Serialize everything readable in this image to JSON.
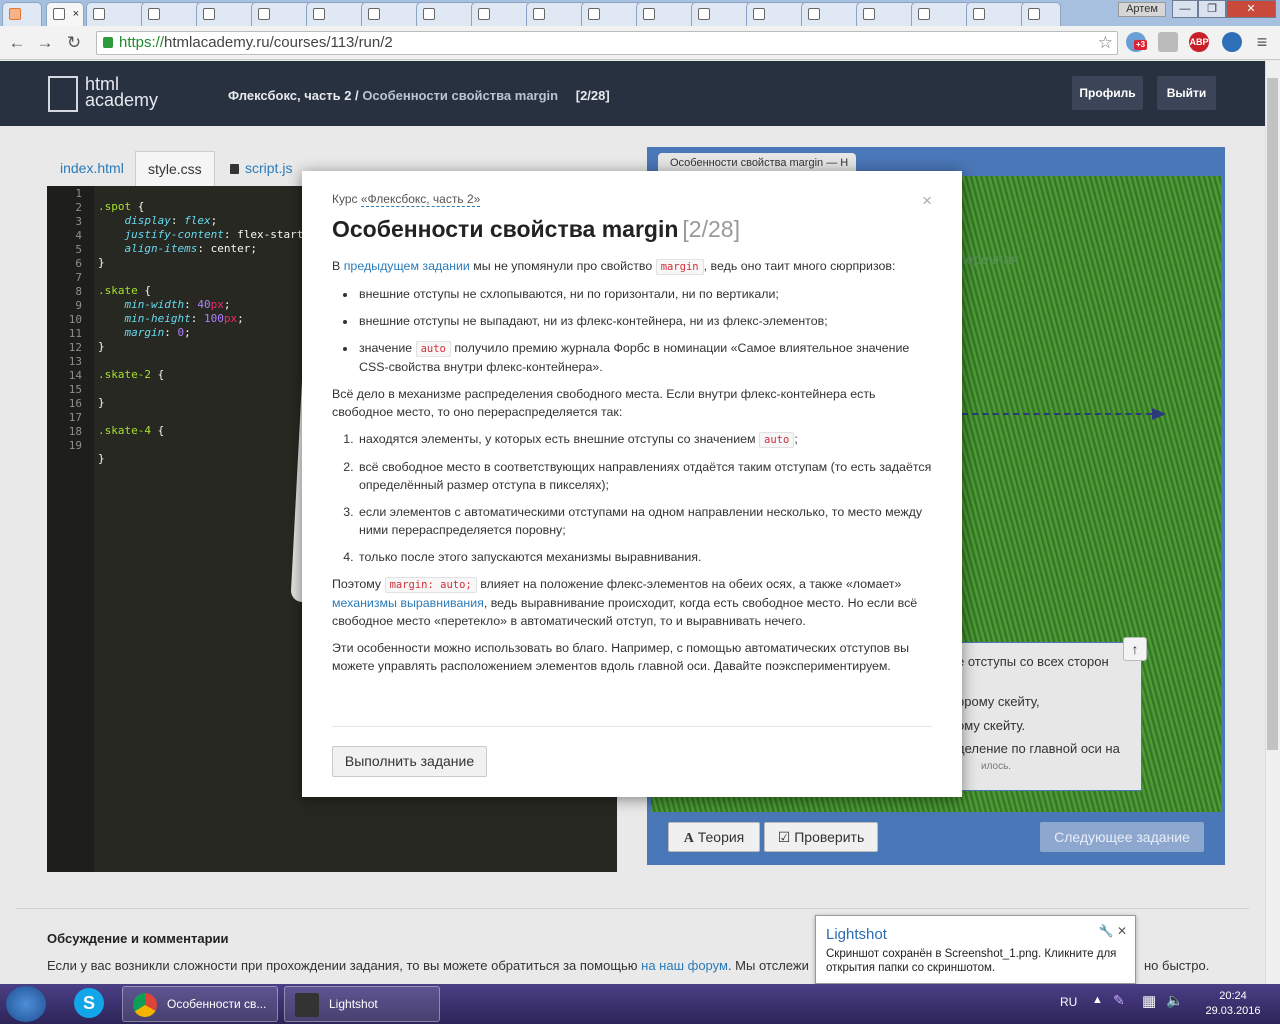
{
  "browser": {
    "tabs": [
      "",
      ""
    ],
    "active_tab_close": "×",
    "profile_name": "Артем",
    "window_controls": {
      "minimize": "—",
      "maximize": "❐",
      "close": "✕"
    },
    "url_protocol": "https://",
    "url_rest": "htmlacademy.ru/courses/113/run/2",
    "ext_badge": "+3",
    "abp": "ABP"
  },
  "site": {
    "logo_line1": "html",
    "logo_line2": "academy",
    "breadcrumb_course": "Флексбокс, часть 2 /",
    "breadcrumb_lesson": "Особенности свойства margin",
    "breadcrumb_count": "[2/28]",
    "profile_button": "Профиль",
    "logout_button": "Выйти"
  },
  "editor": {
    "tabs": [
      "index.html",
      "style.css",
      "script.js"
    ],
    "line_numbers": [
      "1",
      "2",
      "3",
      "4",
      "5",
      "6",
      "7",
      "8",
      "9",
      "10",
      "11",
      "12",
      "13",
      "14",
      "15",
      "16",
      "17",
      "18",
      "19"
    ]
  },
  "preview": {
    "tab_label": "Особенности свойства margin — H",
    "board_label": "перечная",
    "task_lines": [
      "е отступы со всех сторон",
      "орому скейту,",
      "ому скейту.",
      "деление по главной оси на",
      "илось."
    ],
    "theory_button": "Теория",
    "check_button": "Проверить",
    "next_button": "Следующее задание"
  },
  "discussion": {
    "title": "Обсуждение и комментарии",
    "text_before": "Если у вас возникли сложности при прохождении задания, то вы можете обратиться за помощью ",
    "link": "на наш форум",
    "text_after": ". Мы отслежи",
    "tail": "но быстро."
  },
  "modal": {
    "course_prefix": "Курс ",
    "course_link": "«Флексбокс, часть 2»",
    "close": "×",
    "title": "Особенности свойства margin",
    "title_count": "[2/28]",
    "p1_a": "В ",
    "p1_link": "предыдущем задании",
    "p1_b": " мы не упомянули про свойство ",
    "p1_code": "margin",
    "p1_c": ", ведь оно таит много сюрпризов:",
    "bullets": [
      "внешние отступы не схлопываются, ни по горизонтали, ни по вертикали;",
      "внешние отступы не выпадают, ни из флекс-контейнера, ни из флекс-элементов;"
    ],
    "b3_a": "значение ",
    "b3_code": "auto",
    "b3_b": " получило премию журнала Форбс в номинации «Самое влиятельное значение CSS-свойства внутри флекс-контейнера».",
    "p2": "Всё дело в механизме распределения свободного места. Если внутри флекс-контейнера есть свободное место, то оно перераспределяется так:",
    "o1_a": "находятся элементы, у которых есть внешние отступы со значением ",
    "o1_code": "auto",
    "o1_b": ";",
    "ordered": [
      "всё свободное место в соответствующих направлениях отдаётся таким отступам (то есть задаётся определённый размер отступа в пикселях);",
      "если элементов с автоматическими отступами на одном направлении несколько, то место между ними перераспределяется поровну;",
      "только после этого запускаются механизмы выравнивания."
    ],
    "p3_a": "Поэтому ",
    "p3_code": "margin: auto;",
    "p3_b": " влияет на положение флекс-элементов на обеих осях, а также «ломает» ",
    "p3_link": "механизмы выравнивания",
    "p3_c": ", ведь выравнивание происходит, когда есть свободное место. Но если всё свободное место «перетекло» в автоматический отступ, то и выравнивать нечего.",
    "p4": "Эти особенности можно использовать во благо. Например, с помощью автоматических отступов вы можете управлять расположением элементов вдоль главной оси. Давайте поэкспериментируем.",
    "go_button": "Выполнить задание"
  },
  "toast": {
    "title": "Lightshot",
    "message": "Скриншот сохранён в Screenshot_1.png. Кликните для открытия папки со скриншотом."
  },
  "taskbar": {
    "skype": "S",
    "chrome_title": "Особенности св...",
    "lightshot_title": "Lightshot",
    "lang": "RU",
    "time": "20:24",
    "date": "29.03.2016"
  },
  "colors": {
    "header_bg": "#283140",
    "link": "#2b7bb9",
    "preview_frame": "#4a77b8",
    "code_bg": "#272822"
  }
}
